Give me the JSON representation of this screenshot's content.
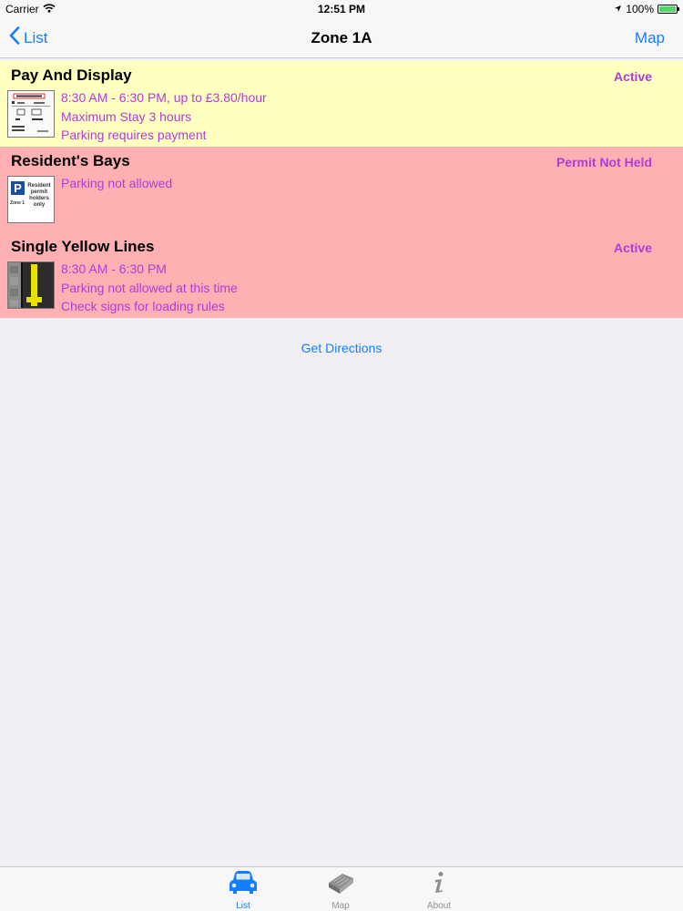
{
  "status_bar": {
    "carrier": "Carrier",
    "time": "12:51 PM",
    "battery": "100%"
  },
  "nav": {
    "back_label": "List",
    "title": "Zone 1A",
    "right_label": "Map"
  },
  "rows": [
    {
      "title": "Pay And Display",
      "status": "Active",
      "icon": "pay-and-display-sign-icon",
      "lines": [
        "8:30 AM - 6:30 PM, up to £3.80/hour",
        "Maximum Stay 3 hours",
        "Parking requires payment"
      ]
    },
    {
      "title": "Resident's Bays",
      "status": "Permit Not Held",
      "icon": "resident-permit-sign-icon",
      "icon_text": {
        "top": "Resident",
        "mid": "permit",
        "bot": "holders",
        "last": "only",
        "zone": "Zone 1"
      },
      "lines": [
        "Parking not allowed"
      ]
    },
    {
      "title": "Single Yellow Lines",
      "status": "Active",
      "icon": "single-yellow-line-icon",
      "lines": [
        "8:30 AM - 6:30 PM",
        "Parking not allowed at this time",
        "Check signs for loading rules"
      ]
    }
  ],
  "directions_label": "Get Directions",
  "tabs": [
    {
      "label": "List",
      "icon": "car-icon",
      "active": true
    },
    {
      "label": "Map",
      "icon": "map-book-icon",
      "active": false
    },
    {
      "label": "About",
      "icon": "info-icon",
      "active": false
    }
  ],
  "colors": {
    "accent": "#147efb",
    "status_text": "#b23bd8",
    "row_yellow": "#ffffc0",
    "row_red": "#ffb0b3"
  }
}
